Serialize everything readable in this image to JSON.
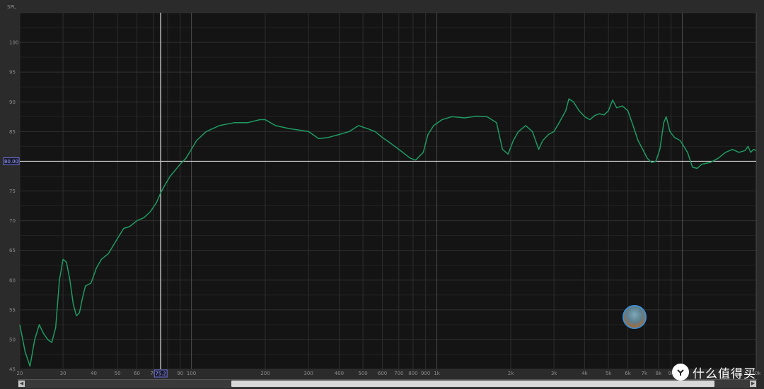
{
  "chart_data": {
    "type": "line",
    "ylabel": "SPL",
    "x_scale": "log",
    "xlim": [
      20,
      20000
    ],
    "ylim": [
      45,
      105
    ],
    "y_ticks": [
      "100",
      "95",
      "90",
      "85",
      "80",
      "75",
      "70",
      "65",
      "60",
      "55",
      "50",
      "45"
    ],
    "x_ticks": [
      {
        "value": 20,
        "label": "20"
      },
      {
        "value": 30,
        "label": "30"
      },
      {
        "value": 40,
        "label": "40"
      },
      {
        "value": 50,
        "label": "50"
      },
      {
        "value": 60,
        "label": "60"
      },
      {
        "value": 70,
        "label": "70"
      },
      {
        "value": 90,
        "label": "90"
      },
      {
        "value": 100,
        "label": "100"
      },
      {
        "value": 200,
        "label": "200"
      },
      {
        "value": 300,
        "label": "300"
      },
      {
        "value": 400,
        "label": "400"
      },
      {
        "value": 500,
        "label": "500"
      },
      {
        "value": 600,
        "label": "600"
      },
      {
        "value": 700,
        "label": "700"
      },
      {
        "value": 800,
        "label": "800"
      },
      {
        "value": 900,
        "label": "900"
      },
      {
        "value": 1000,
        "label": "1k"
      },
      {
        "value": 2000,
        "label": "2k"
      },
      {
        "value": 3000,
        "label": "3k"
      },
      {
        "value": 4000,
        "label": "4k"
      },
      {
        "value": 5000,
        "label": "5k"
      },
      {
        "value": 6000,
        "label": "6k"
      },
      {
        "value": 7000,
        "label": "7k"
      },
      {
        "value": 8000,
        "label": "8k"
      },
      {
        "value": 9000,
        "label": "9k"
      },
      {
        "value": 20000,
        "label": "20k"
      }
    ],
    "grid": true,
    "cursor": {
      "x": 75,
      "x_label": "75.2",
      "y": 80,
      "y_label": "80.00"
    },
    "series": [
      {
        "color": "#1f9a62",
        "points": [
          [
            20,
            52.5
          ],
          [
            21,
            48
          ],
          [
            22,
            45.5
          ],
          [
            23,
            50
          ],
          [
            24,
            52.5
          ],
          [
            25,
            51
          ],
          [
            26,
            50
          ],
          [
            27,
            49.5
          ],
          [
            28,
            52
          ],
          [
            29,
            60
          ],
          [
            30,
            63.5
          ],
          [
            31,
            63
          ],
          [
            32,
            60
          ],
          [
            33,
            56
          ],
          [
            34,
            54
          ],
          [
            35,
            54.5
          ],
          [
            36,
            57
          ],
          [
            37,
            59
          ],
          [
            39,
            59.5
          ],
          [
            41,
            62
          ],
          [
            43,
            63.5
          ],
          [
            46,
            64.5
          ],
          [
            50,
            67
          ],
          [
            53,
            68.7
          ],
          [
            56,
            69
          ],
          [
            60,
            70
          ],
          [
            64,
            70.5
          ],
          [
            68,
            71.5
          ],
          [
            72,
            73
          ],
          [
            75,
            74.7
          ],
          [
            78,
            76
          ],
          [
            82,
            77.5
          ],
          [
            86,
            78.5
          ],
          [
            90,
            79.5
          ],
          [
            95,
            80.5
          ],
          [
            100,
            82
          ],
          [
            105,
            83.5
          ],
          [
            115,
            85
          ],
          [
            130,
            86
          ],
          [
            150,
            86.5
          ],
          [
            170,
            86.5
          ],
          [
            190,
            87
          ],
          [
            200,
            87
          ],
          [
            220,
            86
          ],
          [
            250,
            85.5
          ],
          [
            300,
            85
          ],
          [
            330,
            83.8
          ],
          [
            360,
            84
          ],
          [
            400,
            84.5
          ],
          [
            440,
            85
          ],
          [
            480,
            86
          ],
          [
            520,
            85.5
          ],
          [
            560,
            85
          ],
          [
            600,
            84
          ],
          [
            650,
            83
          ],
          [
            700,
            82
          ],
          [
            780,
            80.5
          ],
          [
            820,
            80.2
          ],
          [
            880,
            81.5
          ],
          [
            920,
            84.5
          ],
          [
            970,
            86
          ],
          [
            1050,
            87
          ],
          [
            1150,
            87.5
          ],
          [
            1300,
            87.3
          ],
          [
            1450,
            87.6
          ],
          [
            1600,
            87.5
          ],
          [
            1750,
            86.5
          ],
          [
            1850,
            82
          ],
          [
            1950,
            81.2
          ],
          [
            2050,
            83.5
          ],
          [
            2150,
            85
          ],
          [
            2300,
            86
          ],
          [
            2450,
            85
          ],
          [
            2600,
            82
          ],
          [
            2700,
            83.5
          ],
          [
            2850,
            84.5
          ],
          [
            3000,
            85
          ],
          [
            3150,
            86.5
          ],
          [
            3350,
            88.5
          ],
          [
            3450,
            90.5
          ],
          [
            3600,
            90
          ],
          [
            3800,
            88.5
          ],
          [
            4000,
            87.5
          ],
          [
            4200,
            87
          ],
          [
            4400,
            87.7
          ],
          [
            4600,
            88
          ],
          [
            4800,
            87.8
          ],
          [
            5000,
            88.5
          ],
          [
            5200,
            90.3
          ],
          [
            5400,
            89
          ],
          [
            5700,
            89.3
          ],
          [
            6000,
            88.5
          ],
          [
            6300,
            86
          ],
          [
            6600,
            83.5
          ],
          [
            6900,
            82
          ],
          [
            7200,
            80.5
          ],
          [
            7500,
            79.8
          ],
          [
            7800,
            80
          ],
          [
            8100,
            82
          ],
          [
            8400,
            86.5
          ],
          [
            8600,
            87.5
          ],
          [
            8900,
            85
          ],
          [
            9300,
            84
          ],
          [
            9800,
            83.5
          ],
          [
            10500,
            81.5
          ],
          [
            11000,
            79
          ],
          [
            11500,
            78.8
          ],
          [
            12000,
            79.5
          ],
          [
            13000,
            79.8
          ],
          [
            14000,
            80.5
          ],
          [
            15000,
            81.5
          ],
          [
            16000,
            82
          ],
          [
            17000,
            81.5
          ],
          [
            18000,
            81.8
          ],
          [
            18500,
            82.5
          ],
          [
            19000,
            81.5
          ],
          [
            19500,
            82
          ],
          [
            20000,
            81.8
          ]
        ]
      }
    ]
  },
  "watermark": {
    "text": "什么值得买",
    "logo_glyph": "值"
  },
  "icons": {
    "scroll_left": "chevron-left-icon",
    "scroll_right": "chevron-right-icon",
    "avatar": "user-avatar-icon"
  }
}
